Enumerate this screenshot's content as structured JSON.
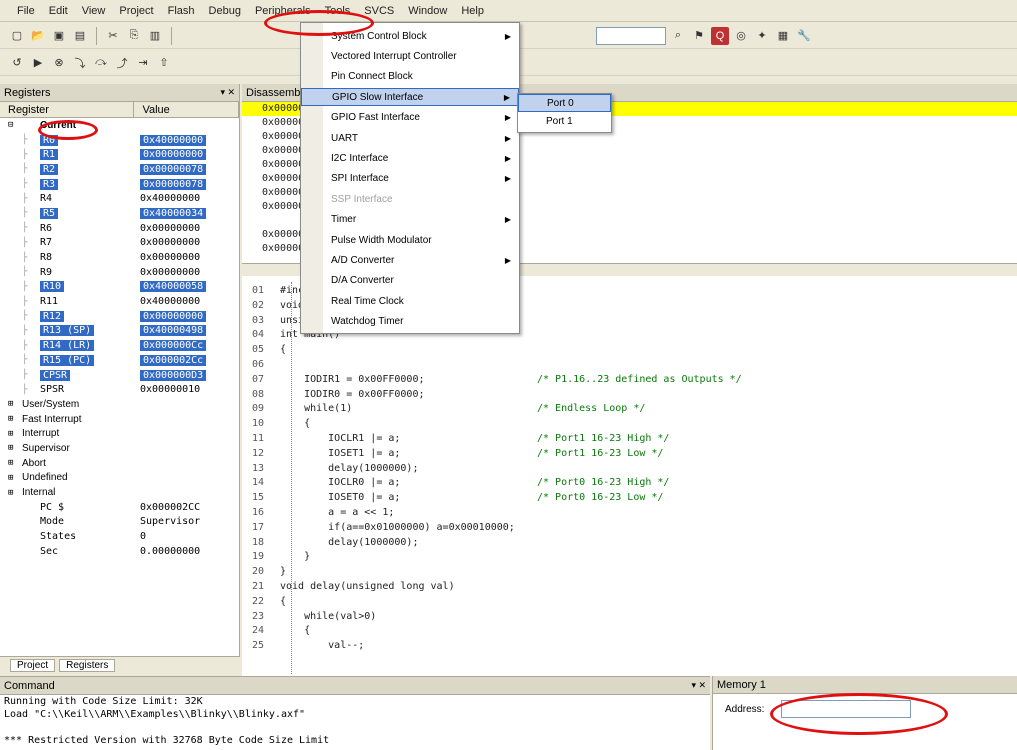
{
  "menubar": [
    "File",
    "Edit",
    "View",
    "Project",
    "Flash",
    "Debug",
    "Peripherals",
    "Tools",
    "SVCS",
    "Window",
    "Help"
  ],
  "registers": {
    "title": "Registers",
    "col_register": "Register",
    "col_value": "Value",
    "current_label": "Current",
    "rows": [
      {
        "name": "R0",
        "value": "0x40000000",
        "sel": true
      },
      {
        "name": "R1",
        "value": "0x00000000",
        "sel": true
      },
      {
        "name": "R2",
        "value": "0x00000078",
        "sel": true
      },
      {
        "name": "R3",
        "value": "0x00000078",
        "sel": true
      },
      {
        "name": "R4",
        "value": "0x40000000",
        "sel": false
      },
      {
        "name": "R5",
        "value": "0x40000034",
        "sel": true
      },
      {
        "name": "R6",
        "value": "0x00000000",
        "sel": false
      },
      {
        "name": "R7",
        "value": "0x00000000",
        "sel": false
      },
      {
        "name": "R8",
        "value": "0x00000000",
        "sel": false
      },
      {
        "name": "R9",
        "value": "0x00000000",
        "sel": false
      },
      {
        "name": "R10",
        "value": "0x40000058",
        "sel": true
      },
      {
        "name": "R11",
        "value": "0x40000000",
        "sel": false
      },
      {
        "name": "R12",
        "value": "0x00000000",
        "sel": true
      },
      {
        "name": "R13 (SP)",
        "value": "0x40000498",
        "sel": true
      },
      {
        "name": "R14 (LR)",
        "value": "0x000000Cc",
        "sel": true
      },
      {
        "name": "R15 (PC)",
        "value": "0x000002Cc",
        "sel": true
      },
      {
        "name": "CPSR",
        "value": "0x000000D3",
        "sel": true
      },
      {
        "name": "SPSR",
        "value": "0x00000010",
        "sel": false
      }
    ],
    "groups": [
      "User/System",
      "Fast Interrupt",
      "Interrupt",
      "Supervisor",
      "Abort",
      "Undefined",
      "Internal"
    ],
    "internal": [
      {
        "name": "PC $",
        "value": "0x000002CC"
      },
      {
        "name": "Mode",
        "value": "Supervisor"
      },
      {
        "name": "States",
        "value": "0"
      },
      {
        "name": "Sec",
        "value": "0.00000000"
      }
    ],
    "tabs": [
      "Project",
      "Registers"
    ]
  },
  "peripherals_menu": {
    "items": [
      {
        "label": "System Control Block",
        "arrow": true,
        "disabled": false
      },
      {
        "label": "Vectored Interrupt Controller",
        "arrow": false,
        "disabled": false
      },
      {
        "label": "Pin Connect Block",
        "arrow": false,
        "disabled": false
      },
      {
        "label": "GPIO Slow Interface",
        "arrow": true,
        "disabled": false,
        "hl": true
      },
      {
        "label": "GPIO Fast Interface",
        "arrow": true,
        "disabled": false
      },
      {
        "label": "UART",
        "arrow": true,
        "disabled": false
      },
      {
        "label": "I2C Interface",
        "arrow": true,
        "disabled": false
      },
      {
        "label": "SPI Interface",
        "arrow": true,
        "disabled": false
      },
      {
        "label": "SSP Interface",
        "arrow": false,
        "disabled": true
      },
      {
        "label": "Timer",
        "arrow": true,
        "disabled": false
      },
      {
        "label": "Pulse Width Modulator",
        "arrow": false,
        "disabled": false
      },
      {
        "label": "A/D Converter",
        "arrow": true,
        "disabled": false
      },
      {
        "label": "D/A Converter",
        "arrow": false,
        "disabled": false
      },
      {
        "label": "Real Time Clock",
        "arrow": false,
        "disabled": false
      },
      {
        "label": "Watchdog Timer",
        "arrow": false,
        "disabled": false
      }
    ],
    "submenu": [
      "Port 0",
      "Port 1"
    ]
  },
  "disassembly": {
    "title": "Disassembly",
    "lines": [
      "0x000002CC  ...",
      "0x000002D0                    0x00000000",
      "0x000002D4    ...",
      "0x000002D8    ...  [R0,#0x0C] ...",
      "0x000002DC    ...  [R1,#0x10] ...",
      "0x000002E0          0x00000000",
      "0x000002E4          _sys_exit:",
      "0x000002E8          B",
      "",
      "0x000002F0          ...",
      "0x000002F4     ...   Integer  ..."
    ]
  },
  "source": {
    "lines": [
      {
        "n": "01",
        "t": "#include <LPC214x.H>"
      },
      {
        "n": "02",
        "t": "void delay(unsigned long val);"
      },
      {
        "n": "03",
        "t": "unsigned int a=0;"
      },
      {
        "n": "04",
        "t": "int main()"
      },
      {
        "n": "05",
        "t": "{"
      },
      {
        "n": "06",
        "t": ""
      },
      {
        "n": "07",
        "t": "    IODIR1 = 0x00FF0000;",
        "c": "/* P1.16..23 defined as Outputs */"
      },
      {
        "n": "08",
        "t": "    IODIR0 = 0x00FF0000;"
      },
      {
        "n": "09",
        "t": "    while(1)",
        "c": "/* Endless Loop */"
      },
      {
        "n": "10",
        "t": "    {"
      },
      {
        "n": "11",
        "t": "        IOCLR1 |= a;",
        "c": "/* Port1 16-23 High */"
      },
      {
        "n": "12",
        "t": "        IOSET1 |= a;",
        "c": "/* Port1 16-23 Low */"
      },
      {
        "n": "13",
        "t": "        delay(1000000);"
      },
      {
        "n": "14",
        "t": "        IOCLR0 |= a;",
        "c": "/* Port0 16-23 High */"
      },
      {
        "n": "15",
        "t": "        IOSET0 |= a;",
        "c": "/* Port0 16-23 Low */"
      },
      {
        "n": "16",
        "t": "        a = a << 1;"
      },
      {
        "n": "17",
        "t": "        if(a==0x01000000) a=0x00010000;"
      },
      {
        "n": "18",
        "t": "        delay(1000000);"
      },
      {
        "n": "19",
        "t": "    }"
      },
      {
        "n": "20",
        "t": "}"
      },
      {
        "n": "21",
        "t": "void delay(unsigned long val)"
      },
      {
        "n": "22",
        "t": "{"
      },
      {
        "n": "23",
        "t": "    while(val>0)"
      },
      {
        "n": "24",
        "t": "    {"
      },
      {
        "n": "25",
        "t": "        val--;"
      }
    ]
  },
  "command": {
    "title": "Command",
    "lines": [
      "Running with Code Size Limit: 32K",
      "Load \"C:\\\\Keil\\\\ARM\\\\Examples\\\\Blinky\\\\Blinky.axf\"",
      "",
      "*** Restricted Version with 32768 Byte Code Size Limit"
    ]
  },
  "memory": {
    "title": "Memory 1",
    "address_label": "Address:",
    "address_value": ""
  }
}
